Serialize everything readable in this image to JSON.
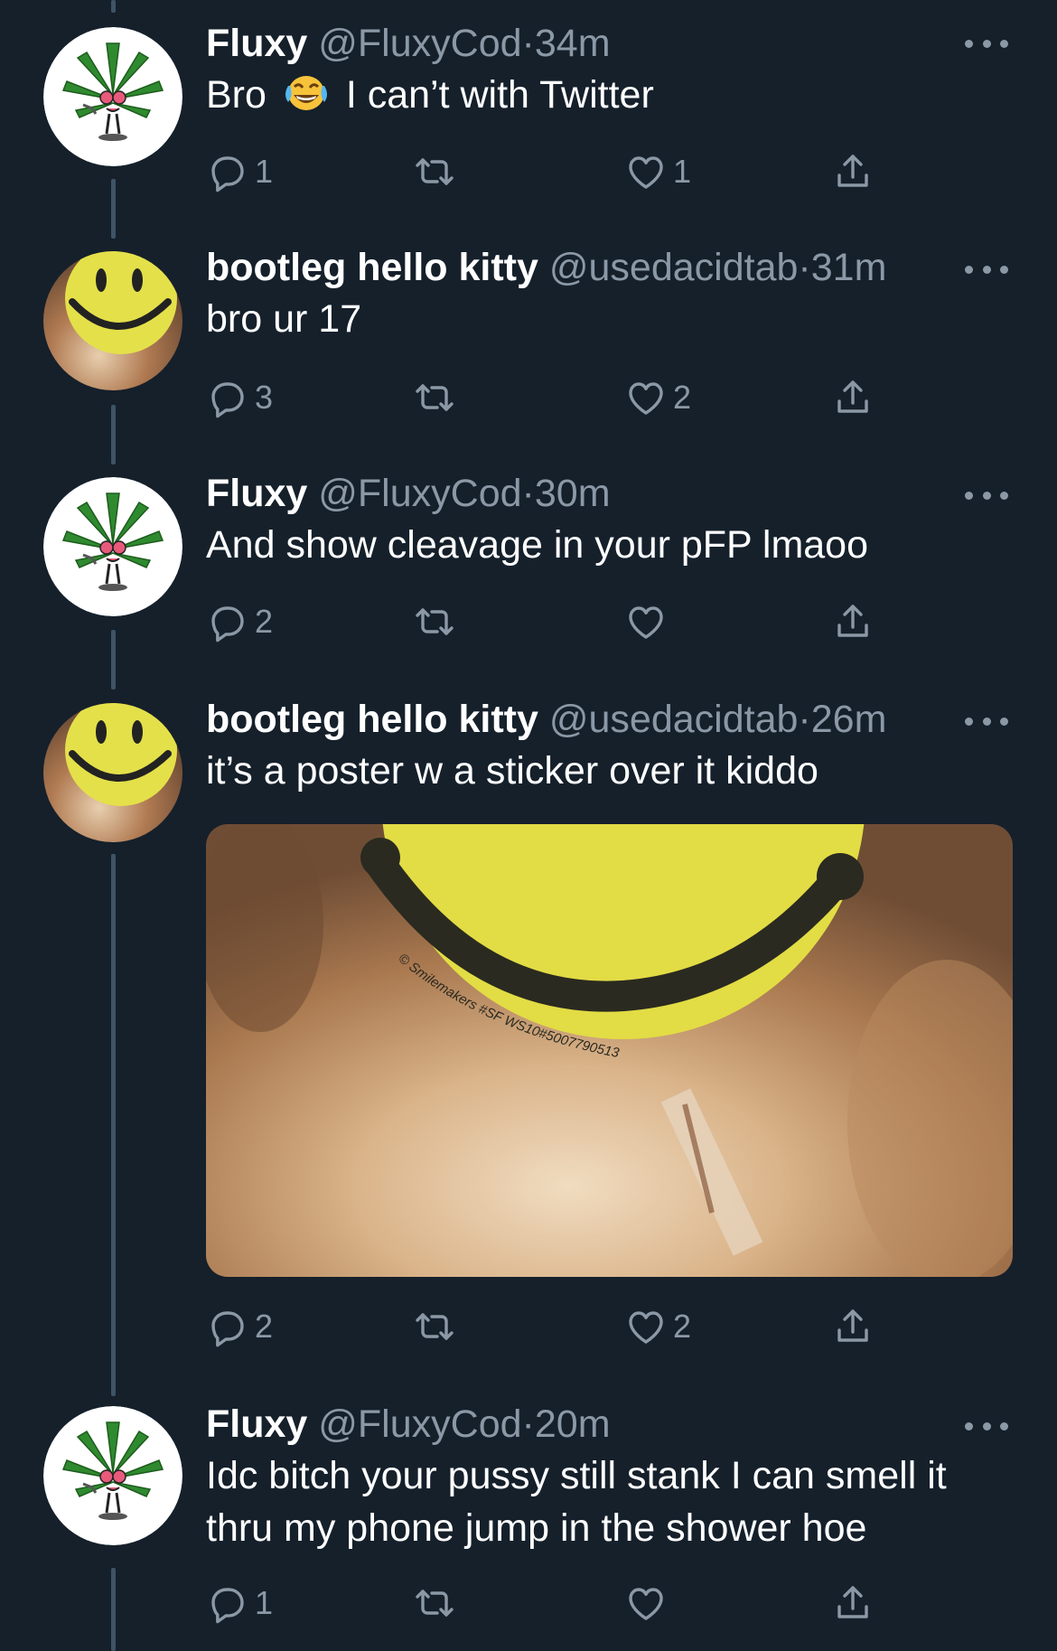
{
  "colors": {
    "background": "#15202b",
    "text": "#ffffff",
    "muted": "#8b98a5",
    "thread_line": "#3d5466"
  },
  "tweets": [
    {
      "name": "Fluxy",
      "handle": "@FluxyCod",
      "sep": "·",
      "time": "34m",
      "text_before": "Bro",
      "emoji": "face-with-tears-of-joy",
      "text_after": "I can’t with Twitter",
      "replies": "1",
      "retweets": "",
      "likes": "1"
    },
    {
      "name": "bootleg hello kitty",
      "handle": "@usedacidtab",
      "sep": "·",
      "time": "31m",
      "text": "bro ur 17",
      "replies": "3",
      "retweets": "",
      "likes": "2"
    },
    {
      "name": "Fluxy",
      "handle": "@FluxyCod",
      "sep": "·",
      "time": "30m",
      "text": "And show cleavage in your pFP lmaoo",
      "replies": "2",
      "retweets": "",
      "likes": ""
    },
    {
      "name": "bootleg hello kitty",
      "handle": "@usedacidtab",
      "sep": "·",
      "time": "26m",
      "text": "it’s a poster w a sticker over it kiddo",
      "image_caption": "© Smilemakers #SF WS10#5007790513",
      "replies": "2",
      "retweets": "",
      "likes": "2"
    },
    {
      "name": "Fluxy",
      "handle": "@FluxyCod",
      "sep": "·",
      "time": "20m",
      "text": "Idc bitch your pussy still stank I can smell it thru my phone jump in the shower hoe",
      "replies": "1",
      "retweets": "",
      "likes": ""
    }
  ],
  "icons": [
    "reply-icon",
    "retweet-icon",
    "like-icon",
    "share-icon",
    "more-icon"
  ]
}
